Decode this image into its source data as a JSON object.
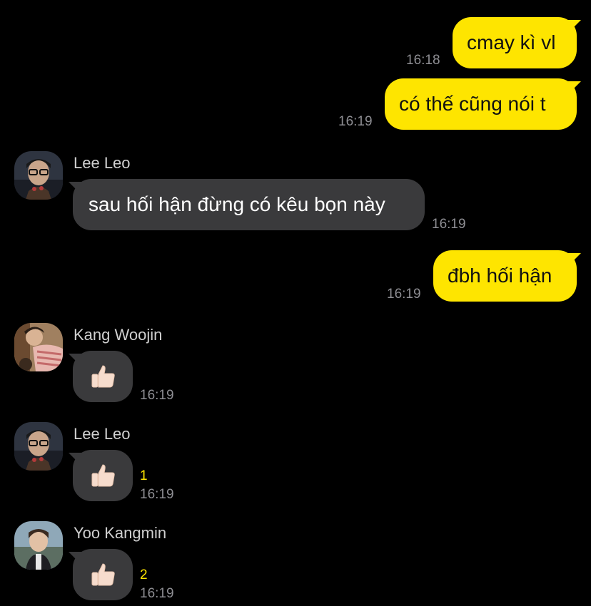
{
  "messages": [
    {
      "type": "outgoing",
      "text": "cmay kì vl",
      "time": "16:18"
    },
    {
      "type": "outgoing",
      "text": "có thế cũng nói t",
      "time": "16:19"
    },
    {
      "type": "incoming",
      "sender": "Lee Leo",
      "avatar_icon": "person-glasses-avatar",
      "text": "sau hối hận đừng có kêu bọn này",
      "time": "16:19"
    },
    {
      "type": "outgoing",
      "text": "đbh hối hận",
      "time": "16:19"
    },
    {
      "type": "incoming-emoji",
      "sender": "Kang Woojin",
      "avatar_icon": "person-striped-shirt-avatar",
      "emoji": "👍🏻",
      "time": "16:19",
      "unread": ""
    },
    {
      "type": "incoming-emoji",
      "sender": "Lee Leo",
      "avatar_icon": "person-glasses-avatar",
      "emoji": "👍🏻",
      "time": "16:19",
      "unread": "1"
    },
    {
      "type": "incoming-emoji",
      "sender": "Yoo Kangmin",
      "avatar_icon": "person-outdoor-avatar",
      "emoji": "👍🏻",
      "time": "16:19",
      "unread": "2"
    }
  ],
  "colors": {
    "background": "#000000",
    "outgoing_bubble": "#fee500",
    "incoming_bubble": "#3a3a3c",
    "timestamp": "#8e8e93",
    "unread_count": "#fee500"
  }
}
